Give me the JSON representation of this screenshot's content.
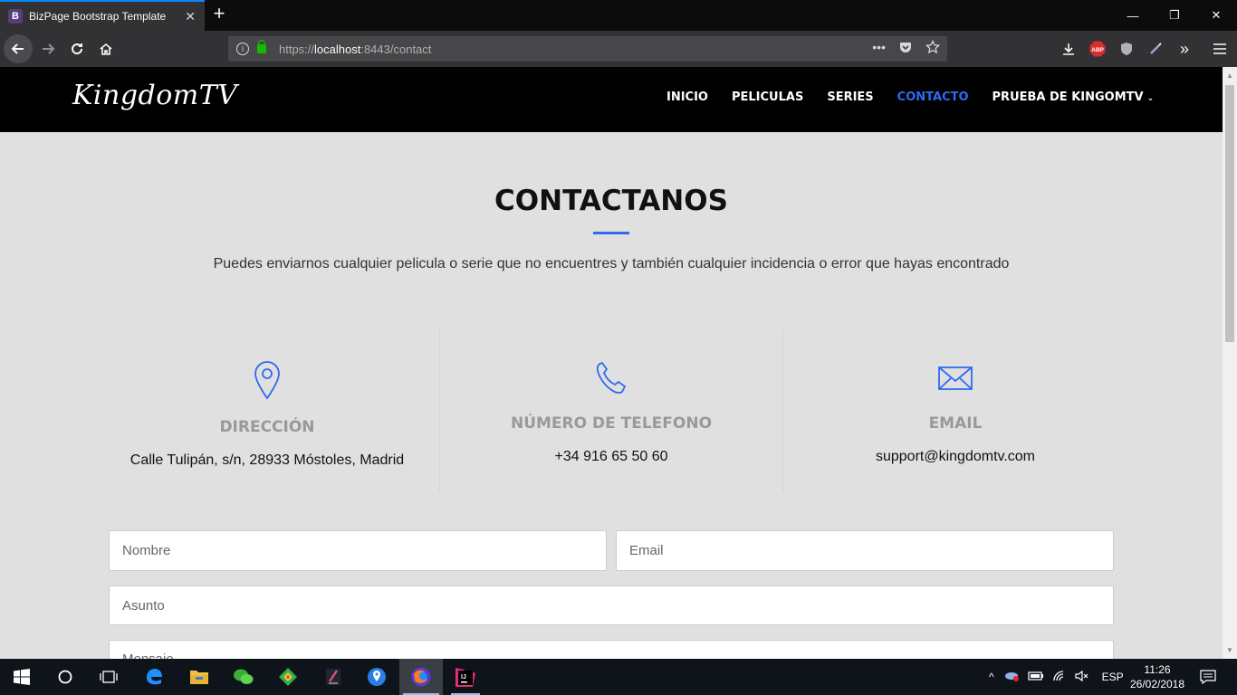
{
  "browser": {
    "tab_title": "BizPage Bootstrap Template",
    "tab_favicon_letter": "B",
    "url_prefix": "https://",
    "url_host": "localhost",
    "url_rest": ":8443/contact",
    "icons": [
      "back-icon",
      "forward-icon",
      "reload-icon",
      "home-icon",
      "info-icon",
      "lock-icon",
      "more-icon",
      "pocket-icon",
      "bookmark-star-icon",
      "download-icon",
      "adblock-icon",
      "shield-icon",
      "pen-icon",
      "overflow-icon",
      "menu-icon"
    ],
    "adblock_label": "ABP"
  },
  "site": {
    "logo": "KingdomTV",
    "nav": [
      {
        "label": "INICIO",
        "active": false
      },
      {
        "label": "PELICULAS",
        "active": false
      },
      {
        "label": "SERIES",
        "active": false
      },
      {
        "label": "CONTACTO",
        "active": true
      },
      {
        "label": "PRUEBA DE KINGOMTV",
        "active": false,
        "dropdown": true
      }
    ],
    "accent_color": "#2f6af0"
  },
  "contact": {
    "title": "CONTACTANOS",
    "description": "Puedes enviarnos cualquier pelicula o serie que no encuentres y también cualquier incidencia o error que hayas encontrado",
    "info": [
      {
        "icon": "map-pin-icon",
        "heading": "DIRECCIÓN",
        "value": "Calle Tulipán, s/n, 28933 Móstoles, Madrid"
      },
      {
        "icon": "phone-icon",
        "heading": "NÚMERO DE TELEFONO",
        "value": "+34 916 65 50 60"
      },
      {
        "icon": "envelope-icon",
        "heading": "EMAIL",
        "value": "support@kingdomtv.com"
      }
    ],
    "form": {
      "name_placeholder": "Nombre",
      "email_placeholder": "Email",
      "subject_placeholder": "Asunto",
      "message_placeholder": "Mensaje"
    }
  },
  "taskbar": {
    "language": "ESP",
    "time": "11:26",
    "date": "26/02/2018"
  }
}
